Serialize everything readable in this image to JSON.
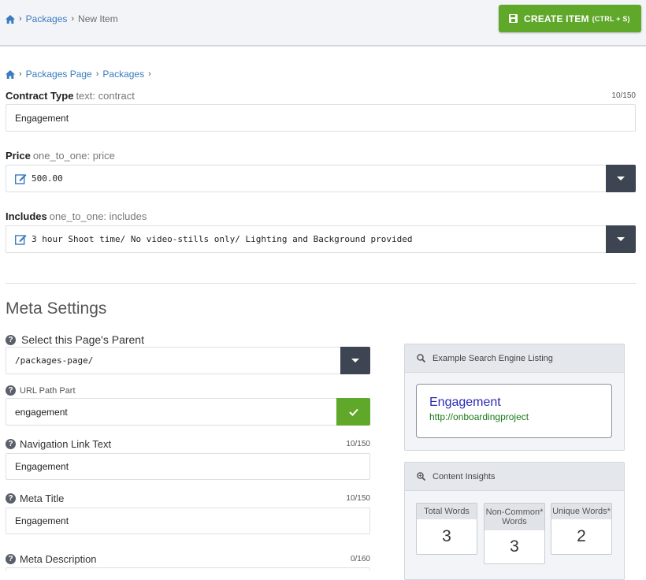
{
  "top_breadcrumb": {
    "packages": "Packages",
    "current": "New Item"
  },
  "toolbar": {
    "create_label": "CREATE ITEM",
    "create_shortcut": "(CTRL + S)"
  },
  "form_breadcrumb": {
    "packages_page": "Packages Page",
    "packages": "Packages"
  },
  "fields": {
    "contract_type": {
      "label": "Contract Type",
      "meta": "text: contract",
      "counter": "10/150",
      "value": "Engagement"
    },
    "price": {
      "label": "Price",
      "meta": "one_to_one: price",
      "value": "500.00"
    },
    "includes": {
      "label": "Includes",
      "meta": "one_to_one: includes",
      "value": "3 hour Shoot time/ No video-stills only/ Lighting and Background provided"
    }
  },
  "meta_settings": {
    "title": "Meta Settings",
    "parent": {
      "label": "Select this Page's Parent",
      "value": "/packages-page/"
    },
    "url_path": {
      "label": "URL Path Part",
      "value": "engagement"
    },
    "nav_link": {
      "label": "Navigation Link Text",
      "counter": "10/150",
      "value": "Engagement"
    },
    "meta_title": {
      "label": "Meta Title",
      "counter": "10/150",
      "value": "Engagement"
    },
    "meta_description": {
      "label": "Meta Description",
      "counter": "0/160"
    }
  },
  "seo_panel": {
    "title": "Example Search Engine Listing",
    "listing_title": "Engagement",
    "listing_url": "http://onboardingproject"
  },
  "insights": {
    "title": "Content Insights",
    "stats": [
      {
        "label": "Total Words",
        "value": "3"
      },
      {
        "label": "Non-Common* Words",
        "value": "3"
      },
      {
        "label": "Unique Words*",
        "value": "2"
      }
    ]
  },
  "colors": {
    "accent_green": "#5fa829",
    "link_blue": "#3b7bbf",
    "dark_button": "#3d4553"
  }
}
